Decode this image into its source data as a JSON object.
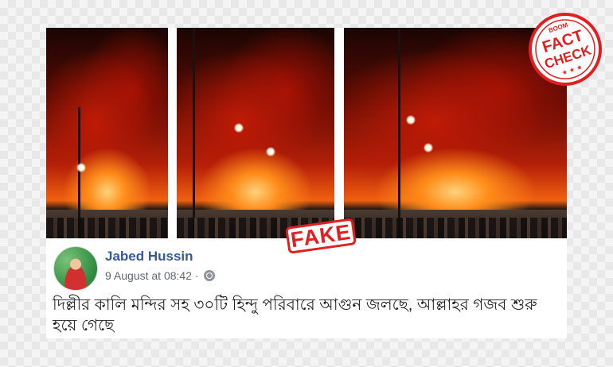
{
  "stamp": {
    "label": "FAKE"
  },
  "badge": {
    "top": "BOOM",
    "line1": "FACT",
    "line2": "CHECK",
    "stars": "★ ★ ★"
  },
  "post": {
    "author": "Jabed Hussin",
    "timestamp": "9 August at 08:42 ·",
    "privacy_icon": "globe-icon",
    "text": "দিল্লীর কালি মন্দির সহ ৩০টি হিন্দু পরিবারে আগুন জলছে, আল্লাহর গজব শুরু হয়ে গেছে"
  },
  "colors": {
    "name_link": "#385898",
    "stamp_red": "#e02020"
  }
}
